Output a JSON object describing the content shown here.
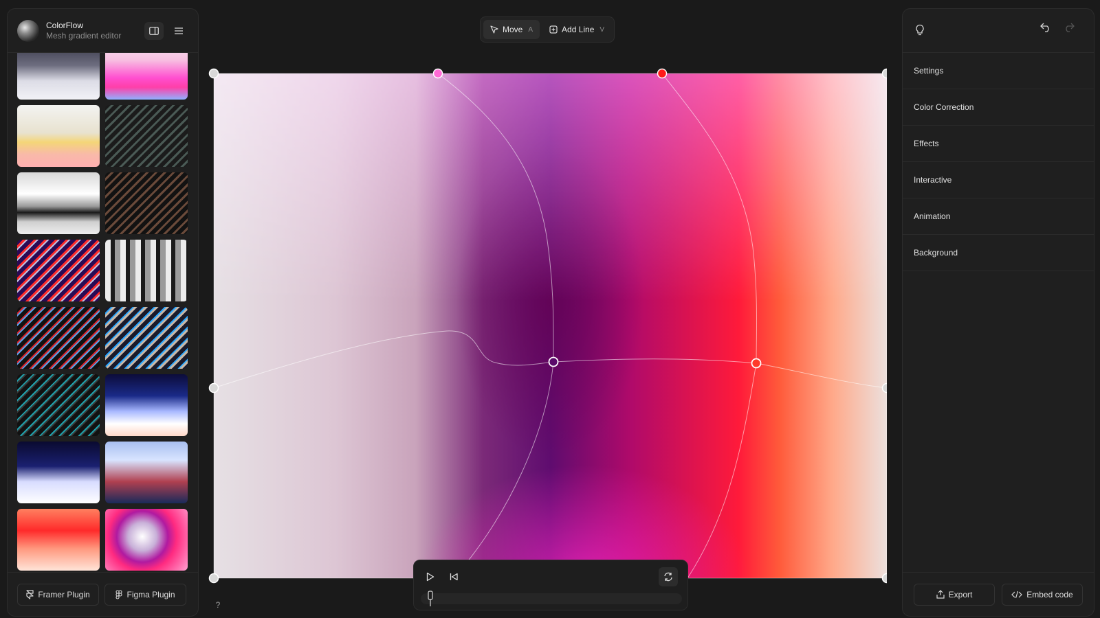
{
  "app": {
    "name": "ColorFlow",
    "subtitle": "Mesh gradient editor"
  },
  "sidebar": {
    "thumbnails": [
      {
        "name": "dark-wave",
        "bg": "linear-gradient(180deg,#2a2a3a 0%,#6e6e80 45%,#dcdce6 70%,#f2f2f6 100%)"
      },
      {
        "name": "pink-blue-wave",
        "bg": "linear-gradient(180deg,#fbe9f4 0%,#f7c3e2 35%,#ff4fd0 65%,#ff3fa8 80%,#8fb0ff 100%)"
      },
      {
        "name": "peach-hills",
        "bg": "linear-gradient(180deg,#f3f3f1 0%,#e8e2cf 45%,#f4d678 60%,#f8b9a9 80%,#ffb0b0 100%)"
      },
      {
        "name": "mint-stripes",
        "bg": "repeating-linear-gradient(135deg,#1b1b1b 0 6px,#4a5a55 6px 9px),linear-gradient(90deg,#222,#888)"
      },
      {
        "name": "white-fold",
        "bg": "linear-gradient(180deg,#d8d8d8 0%,#ffffff 35%,#9a9a9a 55%,#1a1a1a 65%,#cfcfcf 80%,#eeeeee 100%)"
      },
      {
        "name": "orange-stripes",
        "bg": "repeating-linear-gradient(135deg,#121212 0 6px,#6a4a3a 6px 9px)"
      },
      {
        "name": "violet-red-stripes",
        "bg": "repeating-linear-gradient(135deg,#2a0a55 0 6px,#ff2a2a 6px 9px,#c0c0e0 9px 11px)"
      },
      {
        "name": "silver-drapes",
        "bg": "repeating-linear-gradient(90deg,#ececec 0 8px,#1a1a1a 8px 14px,#9a9a9a 14px 22px)"
      },
      {
        "name": "red-blue-stripes",
        "bg": "repeating-linear-gradient(135deg,#111 0 6px,#d8242a 6px 8px,#5aa0e8 8px 10px)"
      },
      {
        "name": "blue-stripes",
        "bg": "repeating-linear-gradient(135deg,#1a1a2a 0 6px,#2aa8ff 6px 8px,#c8b8a8 8px 11px)"
      },
      {
        "name": "teal-stripes",
        "bg": "repeating-linear-gradient(135deg,#111 0 6px,#1fa0aa 6px 8px,#3a3a3a 8px 10px)"
      },
      {
        "name": "navy-cloud",
        "bg": "linear-gradient(180deg,#0c0c3a 0%,#1a2a88 35%,#a8b8ff 60%,#ffffff 80%,#ffd8c8 100%)"
      },
      {
        "name": "navy-snow",
        "bg": "linear-gradient(180deg,#0a0a30 0%,#1a2070 40%,#d8dcff 65%,#ffffff 100%)"
      },
      {
        "name": "sky-red",
        "bg": "linear-gradient(180deg,#a8bff0 0%,#d8e4ff 30%,#b04050 65%,#1a2a5a 100%)"
      },
      {
        "name": "red-coral",
        "bg": "linear-gradient(180deg,#ff8060 0%,#ff2a2a 35%,#ff9a80 65%,#ffe4d8 100%)"
      },
      {
        "name": "pink-ring",
        "bg": "radial-gradient(circle at 45% 45%,#ffffff 0%,#c8b0d8 25%,#b01aa0 45%,#ff2a80 60%,#ffa0d0 100%)"
      }
    ],
    "framer_plugin": "Framer Plugin",
    "figma_plugin": "Figma Plugin"
  },
  "toolbar": {
    "move_label": "Move",
    "move_key": "A",
    "addline_label": "Add Line",
    "addline_key": "V"
  },
  "right_panel": {
    "items": [
      "Settings",
      "Color Correction",
      "Effects",
      "Interactive",
      "Animation",
      "Background"
    ],
    "export_label": "Export",
    "embed_label": "Embed code"
  },
  "help_label": "?",
  "mesh": {
    "handle_colors": {
      "corner": "#d8d8d8",
      "top_pink": "#ff6ad5",
      "top_red": "#ff1a1a",
      "center_purple": "#5a0a6a",
      "center_red": "#ff3a2a"
    }
  }
}
